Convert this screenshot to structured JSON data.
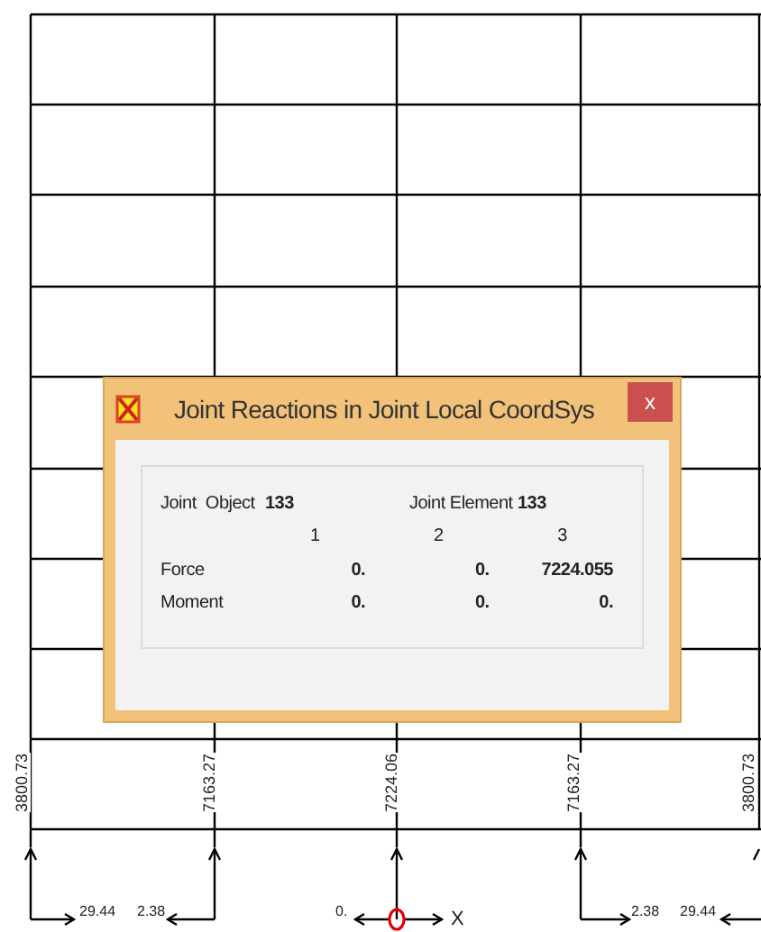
{
  "canvas": {
    "vertical_reactions": [
      "3800.73",
      "7163.27",
      "7224.06",
      "7163.27",
      "3800.73"
    ],
    "horizontal_reactions": [
      "29.44",
      "2.38",
      "0.",
      "2.38",
      "29.44"
    ],
    "axis_label": "X"
  },
  "dialog": {
    "title": "Joint Reactions in Joint Local CoordSys",
    "close": "x",
    "joint_object_label": "Joint  Object",
    "joint_object": "133",
    "joint_element_label": "Joint Element",
    "joint_element": "133",
    "columns": [
      "1",
      "2",
      "3"
    ],
    "rows": [
      {
        "label": "Force",
        "values": [
          "0.",
          "0.",
          "7224.055"
        ]
      },
      {
        "label": "Moment",
        "values": [
          "0.",
          "0.",
          "0."
        ]
      }
    ]
  }
}
